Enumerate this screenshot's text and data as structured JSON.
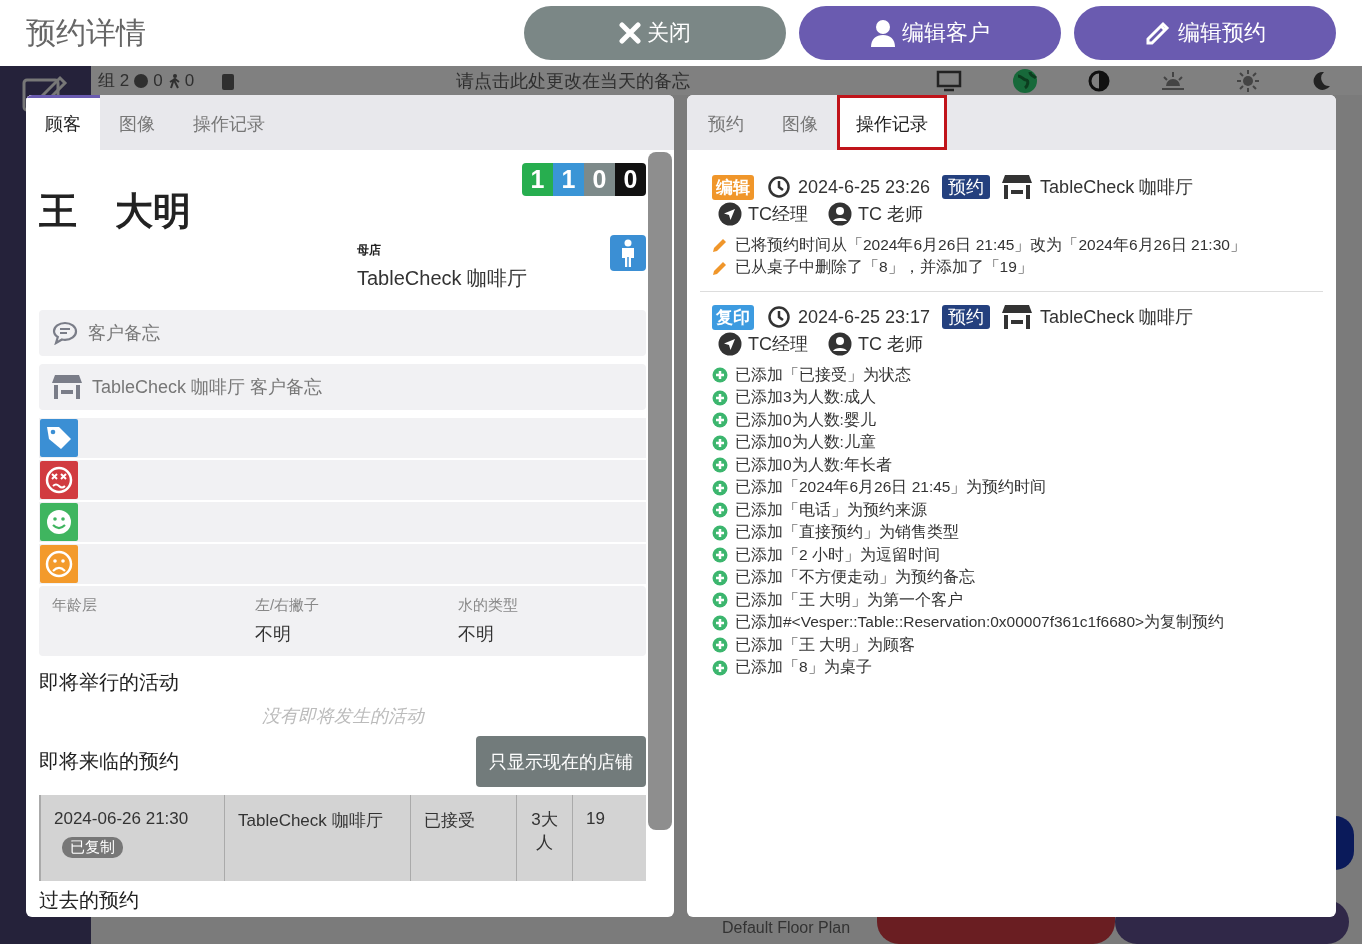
{
  "header": {
    "title": "预约详情",
    "buttons": [
      {
        "label": "关闭",
        "kind": "close"
      },
      {
        "label": "编辑客户",
        "kind": "customer"
      },
      {
        "label": "编辑预约",
        "kind": "reservation"
      }
    ]
  },
  "background": {
    "group": "组 2",
    "count_1": "0",
    "count_2": "0",
    "memo": "请点击此处更改在当天的备忘",
    "floor_plan": "Default Floor Plan"
  },
  "customer_panel": {
    "tabs": [
      {
        "label": "顾客",
        "selected": true
      },
      {
        "label": "图像",
        "selected": false
      },
      {
        "label": "操作记录",
        "selected": false
      }
    ],
    "counters": [
      {
        "value": "1",
        "color": "#27ae4f"
      },
      {
        "value": "1",
        "color": "#3a95d6"
      },
      {
        "value": "0",
        "color": "#7d8a8a"
      },
      {
        "value": "0",
        "color": "#111111"
      }
    ],
    "name": "王　大明",
    "home_store_label": "母店",
    "home_store": "TableCheck 咖啡厅",
    "notes": [
      {
        "kind": "customer",
        "label": "客户备忘"
      },
      {
        "kind": "store",
        "label": "TableCheck 咖啡厅 客户备忘"
      }
    ],
    "tags": [
      {
        "kind": "tag",
        "color": "#3b8fd4"
      },
      {
        "kind": "dizzy",
        "color": "#d13b40"
      },
      {
        "kind": "smile",
        "color": "#3fb55f"
      },
      {
        "kind": "frown",
        "color": "#f39a2b"
      }
    ],
    "attributes": [
      {
        "label": "年龄层"
      },
      {
        "label": "左/右撇子",
        "value": "不明"
      },
      {
        "label": "水的类型",
        "value": "不明"
      }
    ],
    "upcoming_events": {
      "title": "即将举行的活动",
      "empty": "没有即将发生的活动"
    },
    "upcoming_reservations": {
      "title": "即将来临的预约",
      "filter_button": "只显示现在的店铺",
      "rows": [
        {
          "datetime": "2024-06-26 21:30",
          "badge": "已复制",
          "store": "TableCheck 咖啡厅",
          "status": "已接受",
          "party": "3大人",
          "table": "19"
        }
      ]
    },
    "past_reservations": {
      "title": "过去的预约"
    }
  },
  "history_panel": {
    "tabs": [
      {
        "label": "预约",
        "selected": false,
        "outlined": false
      },
      {
        "label": "图像",
        "selected": false,
        "outlined": false
      },
      {
        "label": "操作记录",
        "selected": true,
        "outlined": true
      }
    ],
    "entries": [
      {
        "action": "编辑",
        "kind": "edit",
        "time": "2024-6-25 23:26",
        "type": "预约",
        "store": "TableCheck 咖啡厅",
        "role": "TC经理",
        "user": "TC 老师",
        "changes": [
          {
            "kind": "edit",
            "text": "已将预约时间从「2024年6月26日 21:45」改为「2024年6月26日 21:30」"
          },
          {
            "kind": "edit",
            "text": "已从桌子中删除了「8」，并添加了「19」"
          }
        ]
      },
      {
        "action": "复印",
        "kind": "copy",
        "time": "2024-6-25 23:17",
        "type": "预约",
        "store": "TableCheck 咖啡厅",
        "role": "TC经理",
        "user": "TC 老师",
        "changes": [
          {
            "kind": "add",
            "text": "已添加「已接受」为状态"
          },
          {
            "kind": "add",
            "text": "已添加3为人数:成人"
          },
          {
            "kind": "add",
            "text": "已添加0为人数:婴儿"
          },
          {
            "kind": "add",
            "text": "已添加0为人数:儿童"
          },
          {
            "kind": "add",
            "text": "已添加0为人数:年长者"
          },
          {
            "kind": "add",
            "text": "已添加「2024年6月26日 21:45」为预约时间"
          },
          {
            "kind": "add",
            "text": "已添加「电话」为预约来源"
          },
          {
            "kind": "add",
            "text": "已添加「直接预约」为销售类型"
          },
          {
            "kind": "add",
            "text": "已添加「2 小时」为逗留时间"
          },
          {
            "kind": "add",
            "text": "已添加「不方便走动」为预约备忘"
          },
          {
            "kind": "add",
            "text": "已添加「王 大明」为第一个客户"
          },
          {
            "kind": "add",
            "text": "已添加#<Vesper::Table::Reservation:0x00007f361c1f6680>为复制预约"
          },
          {
            "kind": "add",
            "text": "已添加「王 大明」为顾客"
          },
          {
            "kind": "add",
            "text": "已添加「8」为桌子"
          }
        ]
      }
    ]
  }
}
